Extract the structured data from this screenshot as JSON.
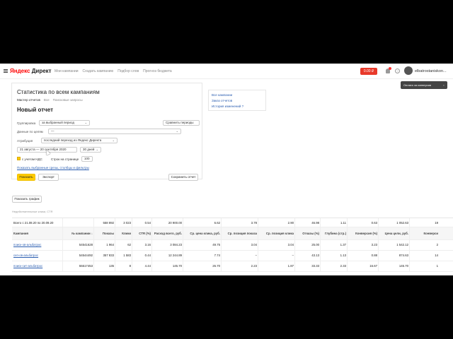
{
  "header": {
    "logo_brand": "Яндекс",
    "logo_product": "Директ",
    "nav": [
      "Мои кампании",
      "Создать кампанию",
      "Подбор слов",
      "Прогноз бюджета"
    ],
    "balance": "0.00 ₽",
    "user": "elbatrostaniskon..."
  },
  "toast": {
    "text": "Оплата за конверсии",
    "close": "×"
  },
  "panel": {
    "title": "Статистика по всем кампаниям",
    "tabs": [
      "Мастер отчетов",
      "Все",
      "Поисковые запросы"
    ],
    "subtitle": "Новый отчет",
    "grouping_label": "Группировка",
    "grouping_value": "за выбранный период",
    "compare_button": "Сравнить периоды",
    "goals_label": "Данные по целям",
    "goals_value": "—",
    "attribution_label": "Атрибуция",
    "attribution_value": "последний переход из Яндекс Директа",
    "date_range": "21 августа — 20 сентября 2020",
    "days": "30 дней",
    "vat_label": "с учетом НДС",
    "rows_label": "Строк на странице",
    "rows_value": "100",
    "show_selected_link": "Показать выбранные срезы, столбцы и фильтры",
    "show_button": "Показать",
    "export_button": "Экспорт",
    "save_button": "Сохранить отчет"
  },
  "side_links": [
    "Все кампании",
    "Заказ отчетов",
    "История изменений ?"
  ],
  "graph_button": "Показать график",
  "note": "Недействительные клики, CTR",
  "table": {
    "total_row": [
      "Всего с 21.08.20 по 20.09.20",
      "",
      "558 892",
      "3 023",
      "0.54",
      "20 900.00",
      "6.62",
      "3.78",
      "2.90",
      "46.98",
      "1.11",
      "0.63",
      "1 052.63",
      "19"
    ],
    "headers": [
      "Кампания",
      "№ кампании ↓",
      "Показы",
      "Клики",
      "CTR (%)",
      "Расход всего, руб.",
      "Ср. цена клика, руб.",
      "Ср. позиция показа",
      "Ср. позиция клика",
      "Отказы (%)",
      "Глубина (стр.)",
      "Конверсия (%)",
      "Цена цели, руб.",
      "Конверси"
    ],
    "rows": [
      [
        "поиск-ов-альбатрос",
        "54541628",
        "1 964",
        "62",
        "3.16",
        "3 084.23",
        "49.75",
        "3.04",
        "3.04",
        "25.00",
        "1.37",
        "3.23",
        "1 542.12",
        "2"
      ],
      [
        "сеп-ов-альбатрос",
        "54544492",
        "357 833",
        "1 583",
        "0.44",
        "12 244.89",
        "7.74",
        "–",
        "–",
        "43.13",
        "1.13",
        "0.88",
        "874.63",
        "14"
      ],
      [
        "поиск-сит-альбатрос",
        "55517453",
        "135",
        "8",
        "4.44",
        "145.70",
        "26.70",
        "2.23",
        "1.87",
        "33.33",
        "2.33",
        "16.67",
        "145.70",
        "1"
      ]
    ]
  }
}
